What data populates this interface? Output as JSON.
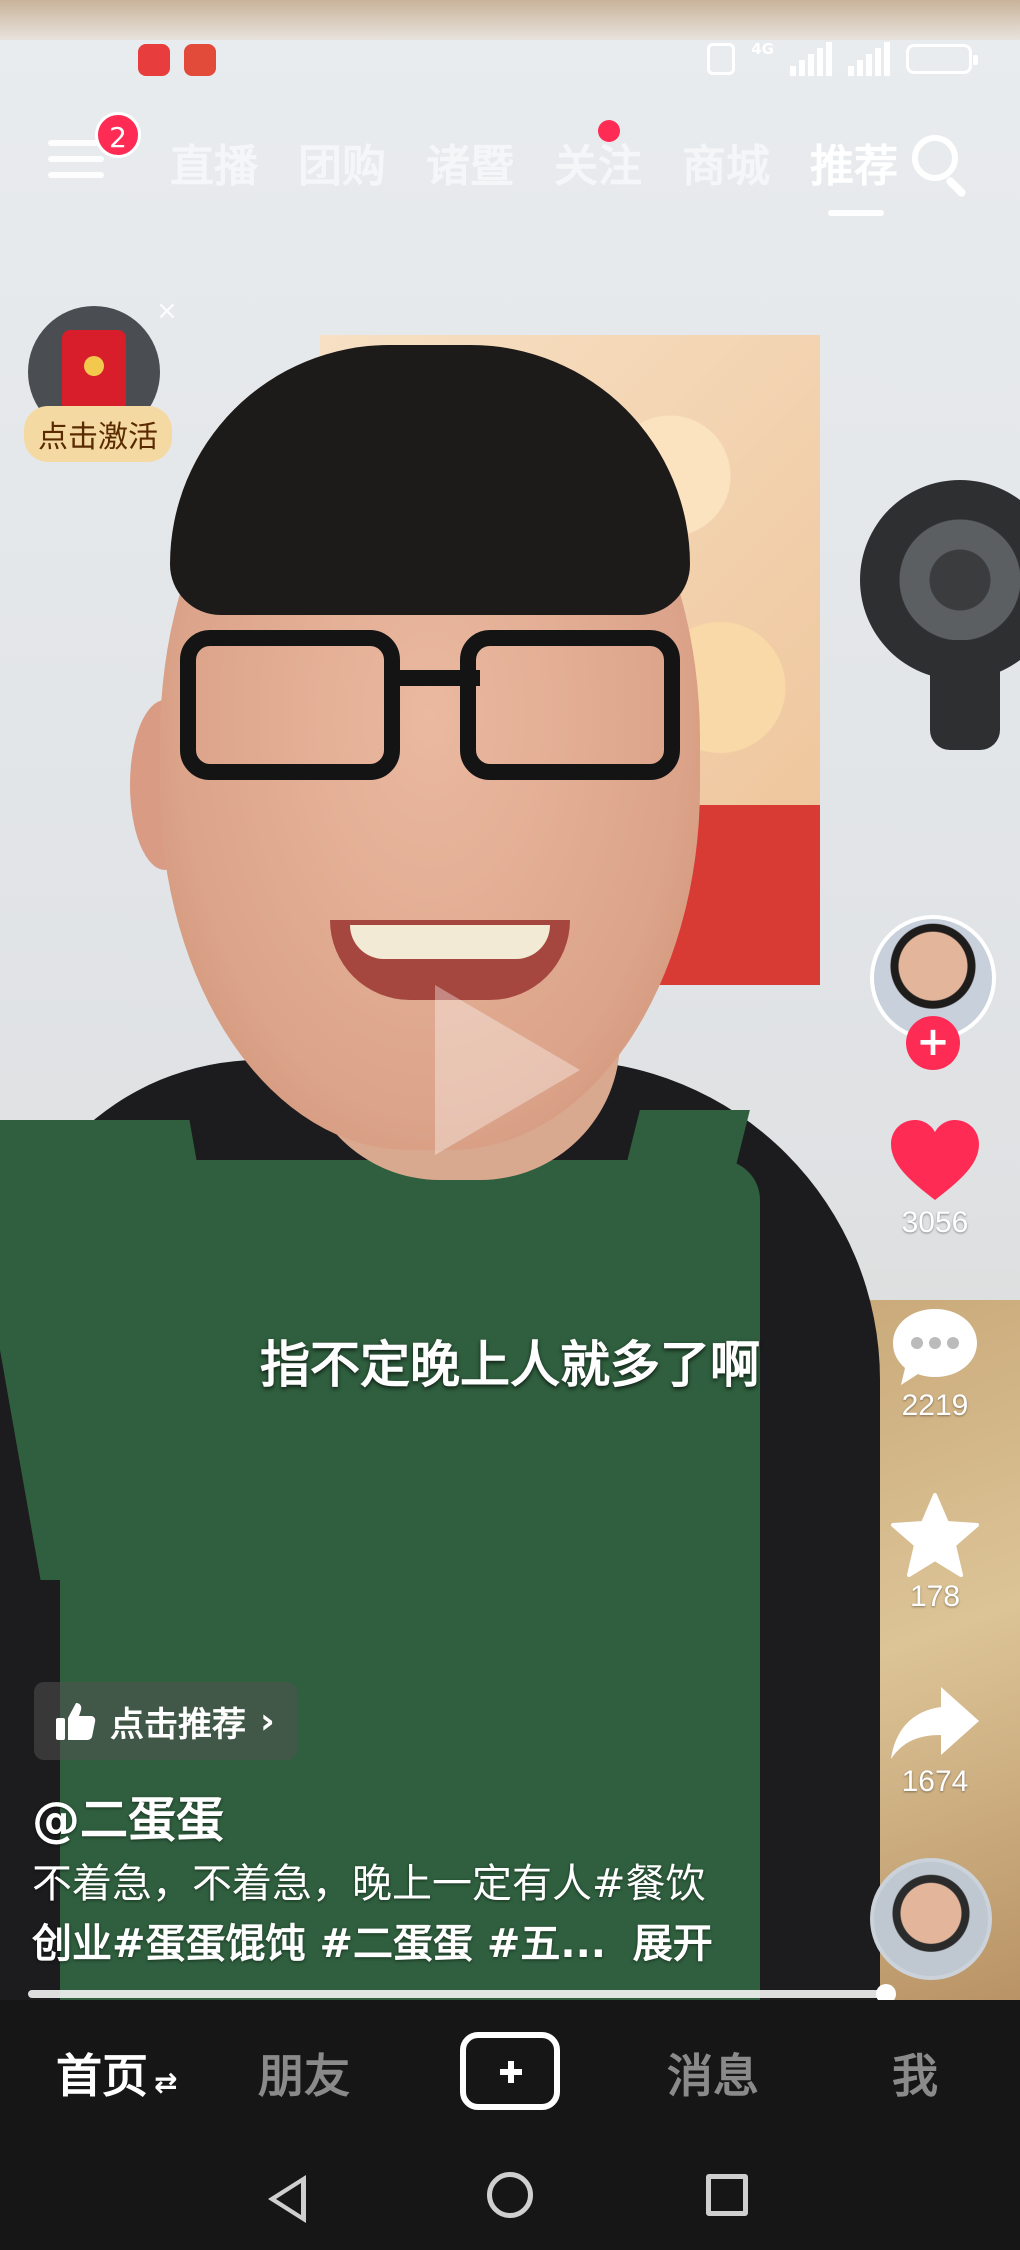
{
  "top_tabs": {
    "menu_badge": "2",
    "tabs": [
      "直播",
      "团购",
      "诸暨",
      "关注",
      "商城",
      "推荐"
    ],
    "active_tab": "推荐"
  },
  "red_packet": {
    "label": "点击激活",
    "close": "×"
  },
  "video": {
    "subtitle": "指不定晚上人就多了啊",
    "recommend_label": "点击推荐",
    "author": "@二蛋蛋",
    "description_line1": "不着急，不着急，晚上一定有人#餐饮",
    "description_line2": "创业#蛋蛋馄饨 #二蛋蛋 #五...",
    "expand_label": "展开",
    "progress_fraction": 0.99
  },
  "rail": {
    "follow": "+",
    "likes": "3056",
    "comments": "2219",
    "favorites": "178",
    "shares": "1674"
  },
  "bottom_nav": {
    "home": "首页",
    "friends": "朋友",
    "messages": "消息",
    "me": "我"
  },
  "colors": {
    "accent": "#fe2c55",
    "nav_bg": "#161616"
  }
}
